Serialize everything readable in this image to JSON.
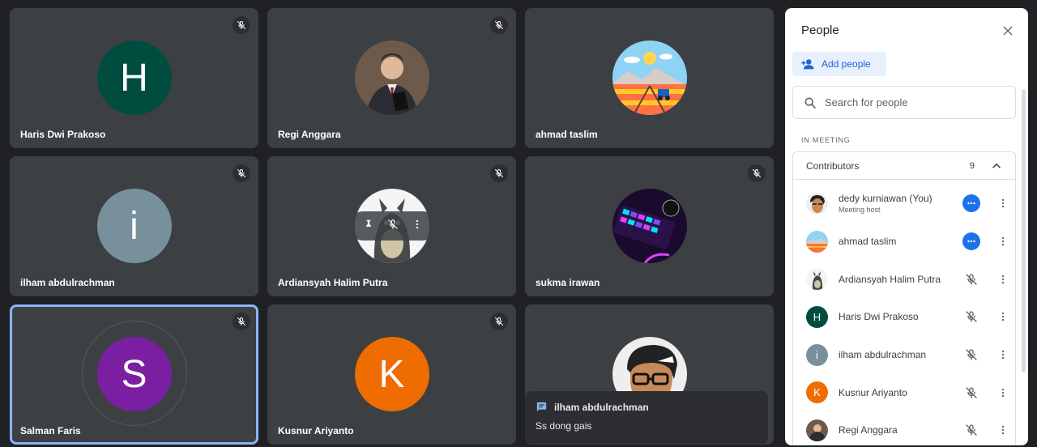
{
  "tiles": [
    {
      "name": "Haris Dwi Prakoso",
      "initial": "H",
      "color": "#004d40"
    },
    {
      "name": "Regi Anggara",
      "photo": "man-in-suit"
    },
    {
      "name": "ahmad taslim",
      "photo": "cartoon-landscape"
    },
    {
      "name": "ilham abdulrachman",
      "initial": "i",
      "color": "#78909c"
    },
    {
      "name": "Ardiansyah Halim Putra",
      "photo": "totoro"
    },
    {
      "name": "sukma irawan",
      "photo": "rgb-keyboard"
    },
    {
      "name": "Salman Faris",
      "initial": "S",
      "color": "#7b1fa2"
    },
    {
      "name": "Kusnur Ariyanto",
      "initial": "K",
      "color": "#ef6c00"
    },
    {
      "name": "",
      "photo": "cartoon-glasses-man"
    }
  ],
  "chat_popup": {
    "sender": "ilham abdulrachman",
    "message": "Ss dong gais"
  },
  "panel": {
    "title": "People",
    "add_people": "Add people",
    "search_placeholder": "Search for people",
    "section_label": "IN MEETING",
    "group": {
      "label": "Contributors",
      "count": "9",
      "people": [
        {
          "name": "dedy kurniawan (You)",
          "sub": "Meeting host",
          "status": "more-options-active",
          "avatar": "photo"
        },
        {
          "name": "ahmad taslim",
          "sub": "",
          "status": "more-options-active",
          "avatar": "photo"
        },
        {
          "name": "Ardiansyah Halim Putra",
          "sub": "",
          "status": "muted",
          "avatar": "photo"
        },
        {
          "name": "Haris Dwi Prakoso",
          "sub": "",
          "status": "muted",
          "avatar": "H",
          "color": "#004d40"
        },
        {
          "name": "ilham abdulrachman",
          "sub": "",
          "status": "muted",
          "avatar": "i",
          "color": "#78909c"
        },
        {
          "name": "Kusnur Ariyanto",
          "sub": "",
          "status": "muted",
          "avatar": "K",
          "color": "#ef6c00"
        },
        {
          "name": "Regi Anggara",
          "sub": "",
          "status": "muted",
          "avatar": "photo"
        }
      ]
    }
  },
  "colors": {
    "accent": "#1a73e8",
    "active_border": "#8ab4f8",
    "tile_bg": "#3c4043",
    "page_bg": "#202124"
  }
}
